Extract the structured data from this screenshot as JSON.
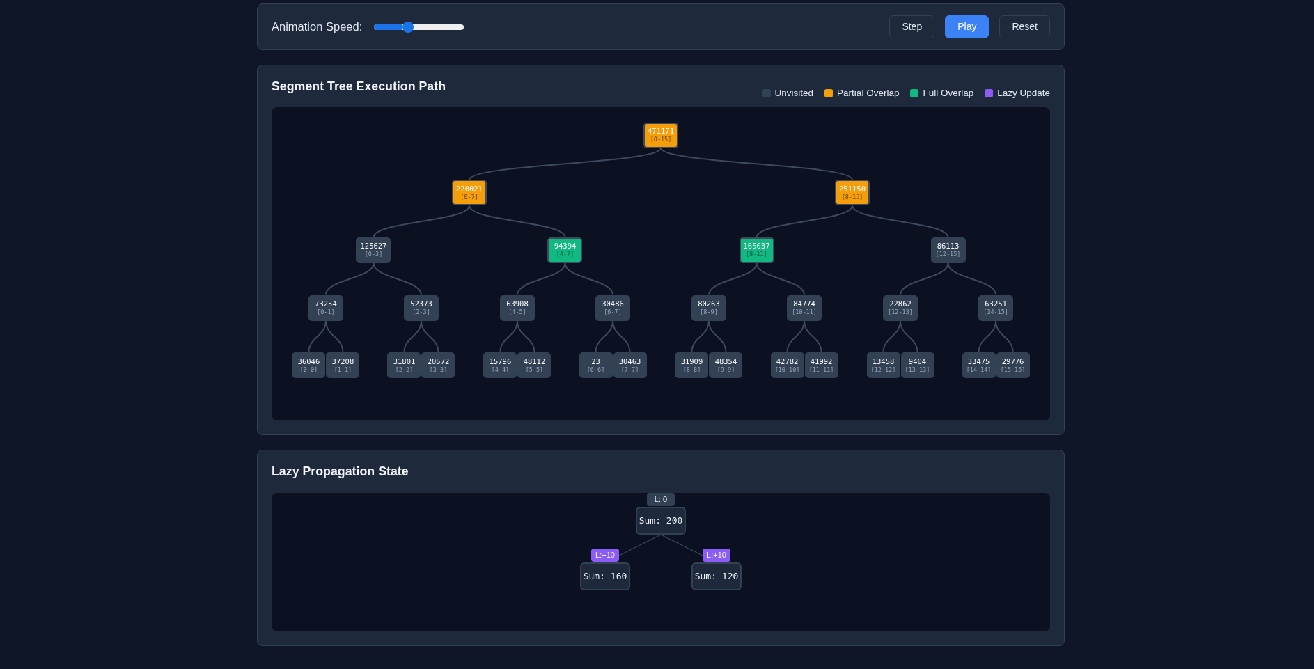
{
  "controls": {
    "speed_label": "Animation Speed:",
    "speed_slider": {
      "level": 0.36
    },
    "buttons": [
      {
        "label": "Step",
        "kind": "outline"
      },
      {
        "label": "Play",
        "kind": "primary"
      },
      {
        "label": "Reset",
        "kind": "outline"
      }
    ]
  },
  "segment_tree": {
    "title": "Segment Tree Execution Path",
    "legend": [
      {
        "label": "Unvisited",
        "color": "#334155"
      },
      {
        "label": "Partial Overlap",
        "color": "#f59e0b"
      },
      {
        "label": "Full Overlap",
        "color": "#10b981"
      },
      {
        "label": "Lazy Update",
        "color": "#8b5cf6"
      }
    ],
    "root": {
      "value": "471171",
      "range": "[0-15]",
      "kind": "partial",
      "children": [
        {
          "value": "220021",
          "range": "[0-7]",
          "kind": "partial",
          "children": [
            {
              "value": "125627",
              "range": "[0-3]",
              "kind": "unvisited",
              "children": [
                {
                  "value": "73254",
                  "range": "[0-1]",
                  "kind": "unvisited",
                  "children": [
                    {
                      "value": "36046",
                      "range": "[0-0]",
                      "kind": "unvisited"
                    },
                    {
                      "value": "37208",
                      "range": "[1-1]",
                      "kind": "unvisited"
                    }
                  ]
                },
                {
                  "value": "52373",
                  "range": "[2-3]",
                  "kind": "unvisited",
                  "children": [
                    {
                      "value": "31801",
                      "range": "[2-2]",
                      "kind": "unvisited"
                    },
                    {
                      "value": "20572",
                      "range": "[3-3]",
                      "kind": "unvisited"
                    }
                  ]
                }
              ]
            },
            {
              "value": "94394",
              "range": "[4-7]",
              "kind": "full",
              "children": [
                {
                  "value": "63908",
                  "range": "[4-5]",
                  "kind": "unvisited",
                  "children": [
                    {
                      "value": "15796",
                      "range": "[4-4]",
                      "kind": "unvisited"
                    },
                    {
                      "value": "48112",
                      "range": "[5-5]",
                      "kind": "unvisited"
                    }
                  ]
                },
                {
                  "value": "30486",
                  "range": "[6-7]",
                  "kind": "unvisited",
                  "children": [
                    {
                      "value": "23",
                      "range": "[6-6]",
                      "kind": "unvisited"
                    },
                    {
                      "value": "30463",
                      "range": "[7-7]",
                      "kind": "unvisited"
                    }
                  ]
                }
              ]
            }
          ]
        },
        {
          "value": "251150",
          "range": "[8-15]",
          "kind": "partial",
          "children": [
            {
              "value": "165037",
              "range": "[8-11]",
              "kind": "full",
              "children": [
                {
                  "value": "80263",
                  "range": "[8-9]",
                  "kind": "unvisited",
                  "children": [
                    {
                      "value": "31909",
                      "range": "[8-8]",
                      "kind": "unvisited"
                    },
                    {
                      "value": "48354",
                      "range": "[9-9]",
                      "kind": "unvisited"
                    }
                  ]
                },
                {
                  "value": "84774",
                  "range": "[10-11]",
                  "kind": "unvisited",
                  "children": [
                    {
                      "value": "42782",
                      "range": "[10-10]",
                      "kind": "unvisited"
                    },
                    {
                      "value": "41992",
                      "range": "[11-11]",
                      "kind": "unvisited"
                    }
                  ]
                }
              ]
            },
            {
              "value": "86113",
              "range": "[12-15]",
              "kind": "unvisited",
              "children": [
                {
                  "value": "22862",
                  "range": "[12-13]",
                  "kind": "unvisited",
                  "children": [
                    {
                      "value": "13458",
                      "range": "[12-12]",
                      "kind": "unvisited"
                    },
                    {
                      "value": "9404",
                      "range": "[13-13]",
                      "kind": "unvisited"
                    }
                  ]
                },
                {
                  "value": "63251",
                  "range": "[14-15]",
                  "kind": "unvisited",
                  "children": [
                    {
                      "value": "33475",
                      "range": "[14-14]",
                      "kind": "unvisited"
                    },
                    {
                      "value": "29776",
                      "range": "[15-15]",
                      "kind": "unvisited"
                    }
                  ]
                }
              ]
            }
          ]
        }
      ]
    }
  },
  "lazy_propagation": {
    "title": "Lazy Propagation State",
    "root": {
      "sum": "Sum: 200",
      "lazy": "L: 0",
      "pending": false,
      "children": [
        {
          "sum": "Sum: 160",
          "lazy": "L:+10",
          "pending": true
        },
        {
          "sum": "Sum: 120",
          "lazy": "L:+10",
          "pending": true
        }
      ]
    }
  }
}
